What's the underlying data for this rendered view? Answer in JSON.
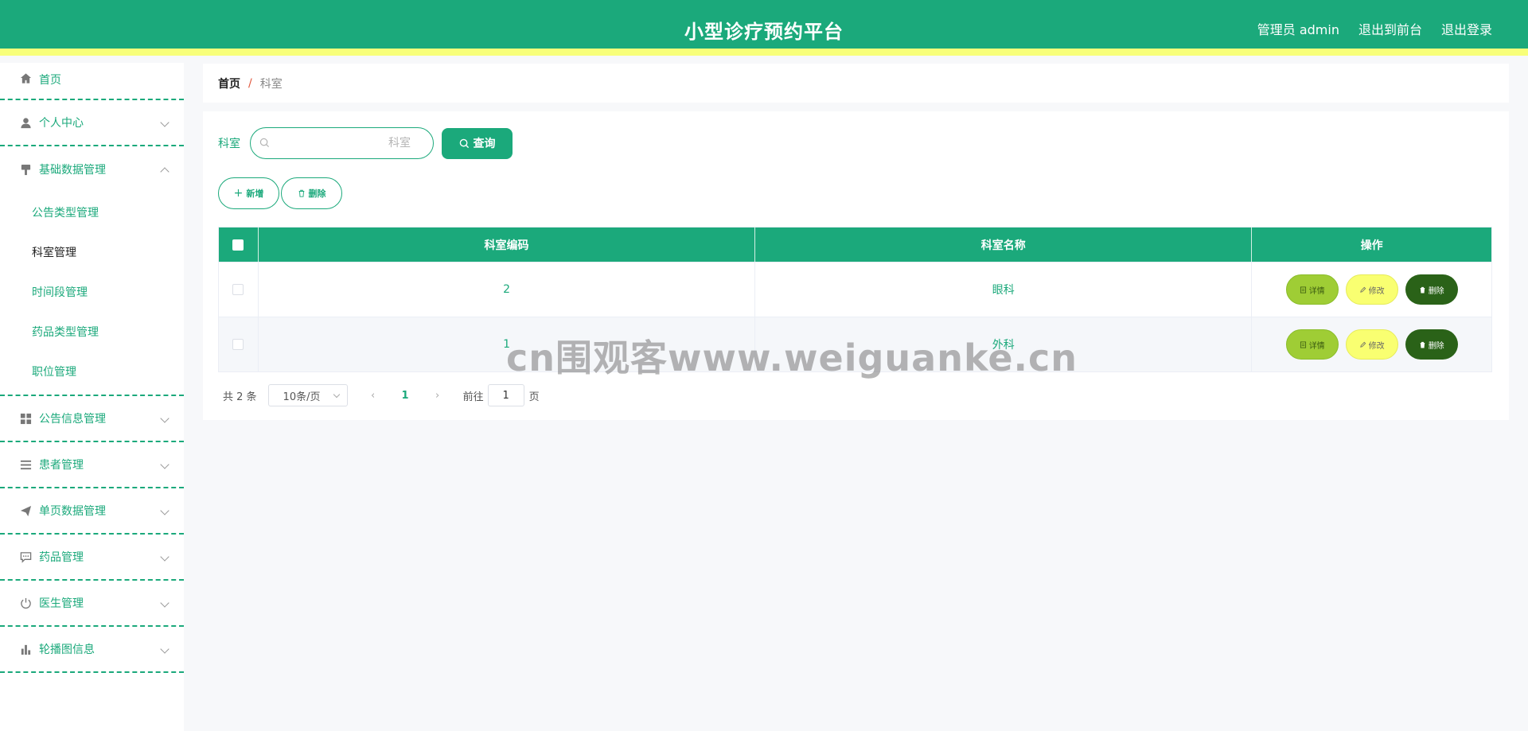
{
  "header": {
    "title": "小型诊疗预约平台",
    "admin_label": "管理员 admin",
    "front_label": "退出到前台",
    "logout_label": "退出登录"
  },
  "sidebar": {
    "home": "首页",
    "personal": "个人中心",
    "basic": "基础数据管理",
    "basic_sub": [
      "公告类型管理",
      "科室管理",
      "时间段管理",
      "药品类型管理",
      "职位管理"
    ],
    "notice": "公告信息管理",
    "patient": "患者管理",
    "single_page": "单页数据管理",
    "medicine": "药品管理",
    "doctor": "医生管理",
    "carousel": "轮播图信息"
  },
  "breadcrumb": {
    "home": "首页",
    "sep": "/",
    "current": "科室"
  },
  "search": {
    "label": "科室",
    "placeholder": "科室",
    "value": "",
    "button": "查询"
  },
  "actions": {
    "add": "新增",
    "delete": "删除"
  },
  "table": {
    "headers": [
      "科室编码",
      "科室名称",
      "操作"
    ],
    "rows": [
      {
        "code": "2",
        "name": "眼科"
      },
      {
        "code": "1",
        "name": "外科"
      }
    ],
    "ops": {
      "detail": "详情",
      "edit": "修改",
      "delete": "删除"
    }
  },
  "pagination": {
    "total": "共 2 条",
    "page_size": "10条/页",
    "current_page": "1",
    "goto_label": "前往",
    "goto_value": "1",
    "page_suffix": "页"
  },
  "watermark": "cn围观客www.weiguanke.cn",
  "colors": {
    "primary": "#1ba97b",
    "accent_bar": "#f8ff7a",
    "detail_btn": "#9fcd35",
    "edit_btn": "#f9ff71",
    "delete_btn": "#2a6218"
  }
}
